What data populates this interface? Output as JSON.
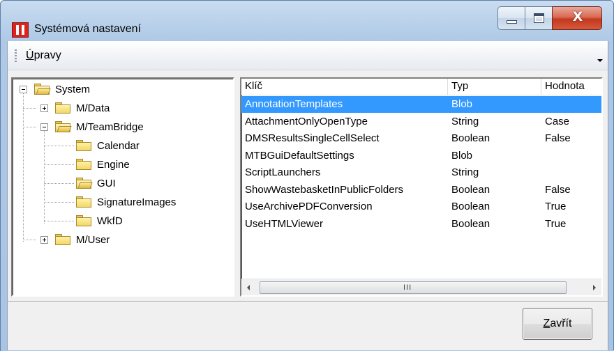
{
  "window": {
    "title": "Systémová nastavení",
    "controls": {
      "minimize": "minimize-icon",
      "maximize": "maximize-icon",
      "close": "close-icon",
      "close_glyph": "X"
    }
  },
  "menubar": {
    "menu_upravy_mnemonic": "Ú",
    "menu_upravy_rest": "pravy"
  },
  "tree": {
    "items": [
      {
        "label": "System",
        "depth": 0,
        "expander": "minus",
        "folder": "open"
      },
      {
        "label": "M/Data",
        "depth": 1,
        "expander": "plus",
        "folder": "closed"
      },
      {
        "label": "M/TeamBridge",
        "depth": 1,
        "expander": "minus",
        "folder": "open"
      },
      {
        "label": "Calendar",
        "depth": 2,
        "expander": "none",
        "folder": "closed"
      },
      {
        "label": "Engine",
        "depth": 2,
        "expander": "none",
        "folder": "closed"
      },
      {
        "label": "GUI",
        "depth": 2,
        "expander": "none",
        "folder": "open",
        "selected": true
      },
      {
        "label": "SignatureImages",
        "depth": 2,
        "expander": "none",
        "folder": "closed"
      },
      {
        "label": "WkfD",
        "depth": 2,
        "expander": "none",
        "folder": "closed"
      },
      {
        "label": "M/User",
        "depth": 1,
        "expander": "plus",
        "folder": "closed"
      }
    ]
  },
  "list": {
    "columns": [
      "Klíč",
      "Typ",
      "Hodnota"
    ],
    "rows": [
      {
        "key": "AnnotationTemplates",
        "type": "Blob",
        "value": "",
        "selected": true
      },
      {
        "key": "AttachmentOnlyOpenType",
        "type": "String",
        "value": "Case"
      },
      {
        "key": "DMSResultsSingleCellSelect",
        "type": "Boolean",
        "value": "False"
      },
      {
        "key": "MTBGuiDefaultSettings",
        "type": "Blob",
        "value": ""
      },
      {
        "key": "ScriptLaunchers",
        "type": "String",
        "value": ""
      },
      {
        "key": "ShowWastebasketInPublicFolders",
        "type": "Boolean",
        "value": "False"
      },
      {
        "key": "UseArchivePDFConversion",
        "type": "Boolean",
        "value": "True"
      },
      {
        "key": "UseHTMLViewer",
        "type": "Boolean",
        "value": "True"
      }
    ],
    "scrollbar_grip": "III"
  },
  "footer": {
    "close_mnemonic": "Z",
    "close_rest": "avřít"
  },
  "colors": {
    "selection": "#3399ff",
    "folder": "#f1d764",
    "title_icon": "#d8241c"
  }
}
